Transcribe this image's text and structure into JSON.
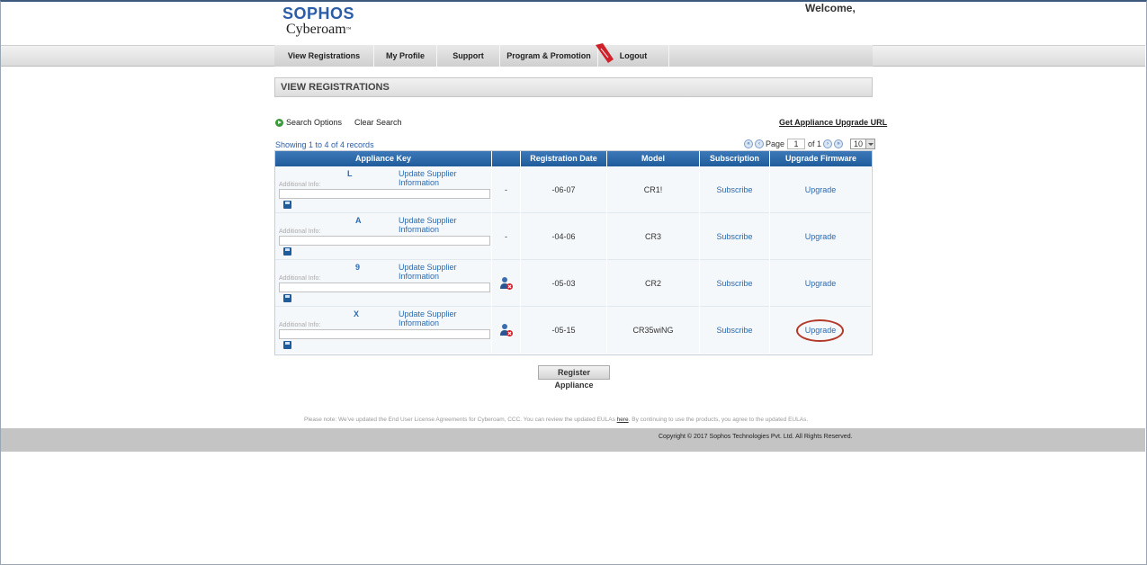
{
  "header": {
    "logo_brand": "SOPHOS",
    "logo_product": "Cyberoam",
    "logo_tm": "™",
    "welcome": "Welcome,"
  },
  "nav": {
    "items": [
      {
        "label": "View Registrations"
      },
      {
        "label": "My Profile"
      },
      {
        "label": "Support"
      },
      {
        "label": "Program & Promotion"
      },
      {
        "label": "Logout"
      }
    ]
  },
  "page": {
    "title": "VIEW REGISTRATIONS",
    "search_options": "Search Options",
    "clear_search": "Clear Search",
    "upgrade_url": "Get Appliance Upgrade URL",
    "showing": "Showing 1 to 4 of 4 records"
  },
  "pager": {
    "page_label": "Page",
    "page_value": "1",
    "of_label": "of 1",
    "page_size": "10"
  },
  "table": {
    "headers": [
      "Appliance Key",
      "",
      "Registration Date",
      "Model",
      "Subscription",
      "Upgrade Firmware"
    ],
    "rows": [
      {
        "key": "L",
        "supplier": "Update Supplier Information",
        "addl_label": "Additional Info:",
        "status": "-",
        "date": "-06-07",
        "model": "CR1!",
        "subscription": "Subscribe",
        "upgrade": "Upgrade"
      },
      {
        "key": "A",
        "supplier": "Update Supplier Information",
        "addl_label": "Additional Info:",
        "status": "-",
        "date": "-04-06",
        "model": "CR3",
        "subscription": "Subscribe",
        "upgrade": "Upgrade"
      },
      {
        "key": "9",
        "supplier": "Update Supplier Information",
        "addl_label": "Additional Info:",
        "status": "",
        "date": "-05-03",
        "model": "CR2",
        "subscription": "Subscribe",
        "upgrade": "Upgrade"
      },
      {
        "key": "X",
        "supplier": "Update Supplier Information",
        "addl_label": "Additional Info:",
        "status": "",
        "date": "-05-15",
        "model": "CR35wiNG",
        "subscription": "Subscribe",
        "upgrade": "Upgrade"
      }
    ]
  },
  "actions": {
    "register": "Register Appliance"
  },
  "footer": {
    "note_pre": "Please note: We've updated the End User License Agreements for Cyberoam, CCC. You can review the updated EULAs ",
    "note_link": "here",
    "note_post": ". By continuing to use the products, you agree to the updated EULAs.",
    "copyright": "Copyright © 2017 Sophos Technologies Pvt. Ltd. All Rights Reserved."
  },
  "colors": {
    "brand": "#2b5ea7",
    "header_blue": "#1f5c9c",
    "highlight": "#b33a2b"
  }
}
